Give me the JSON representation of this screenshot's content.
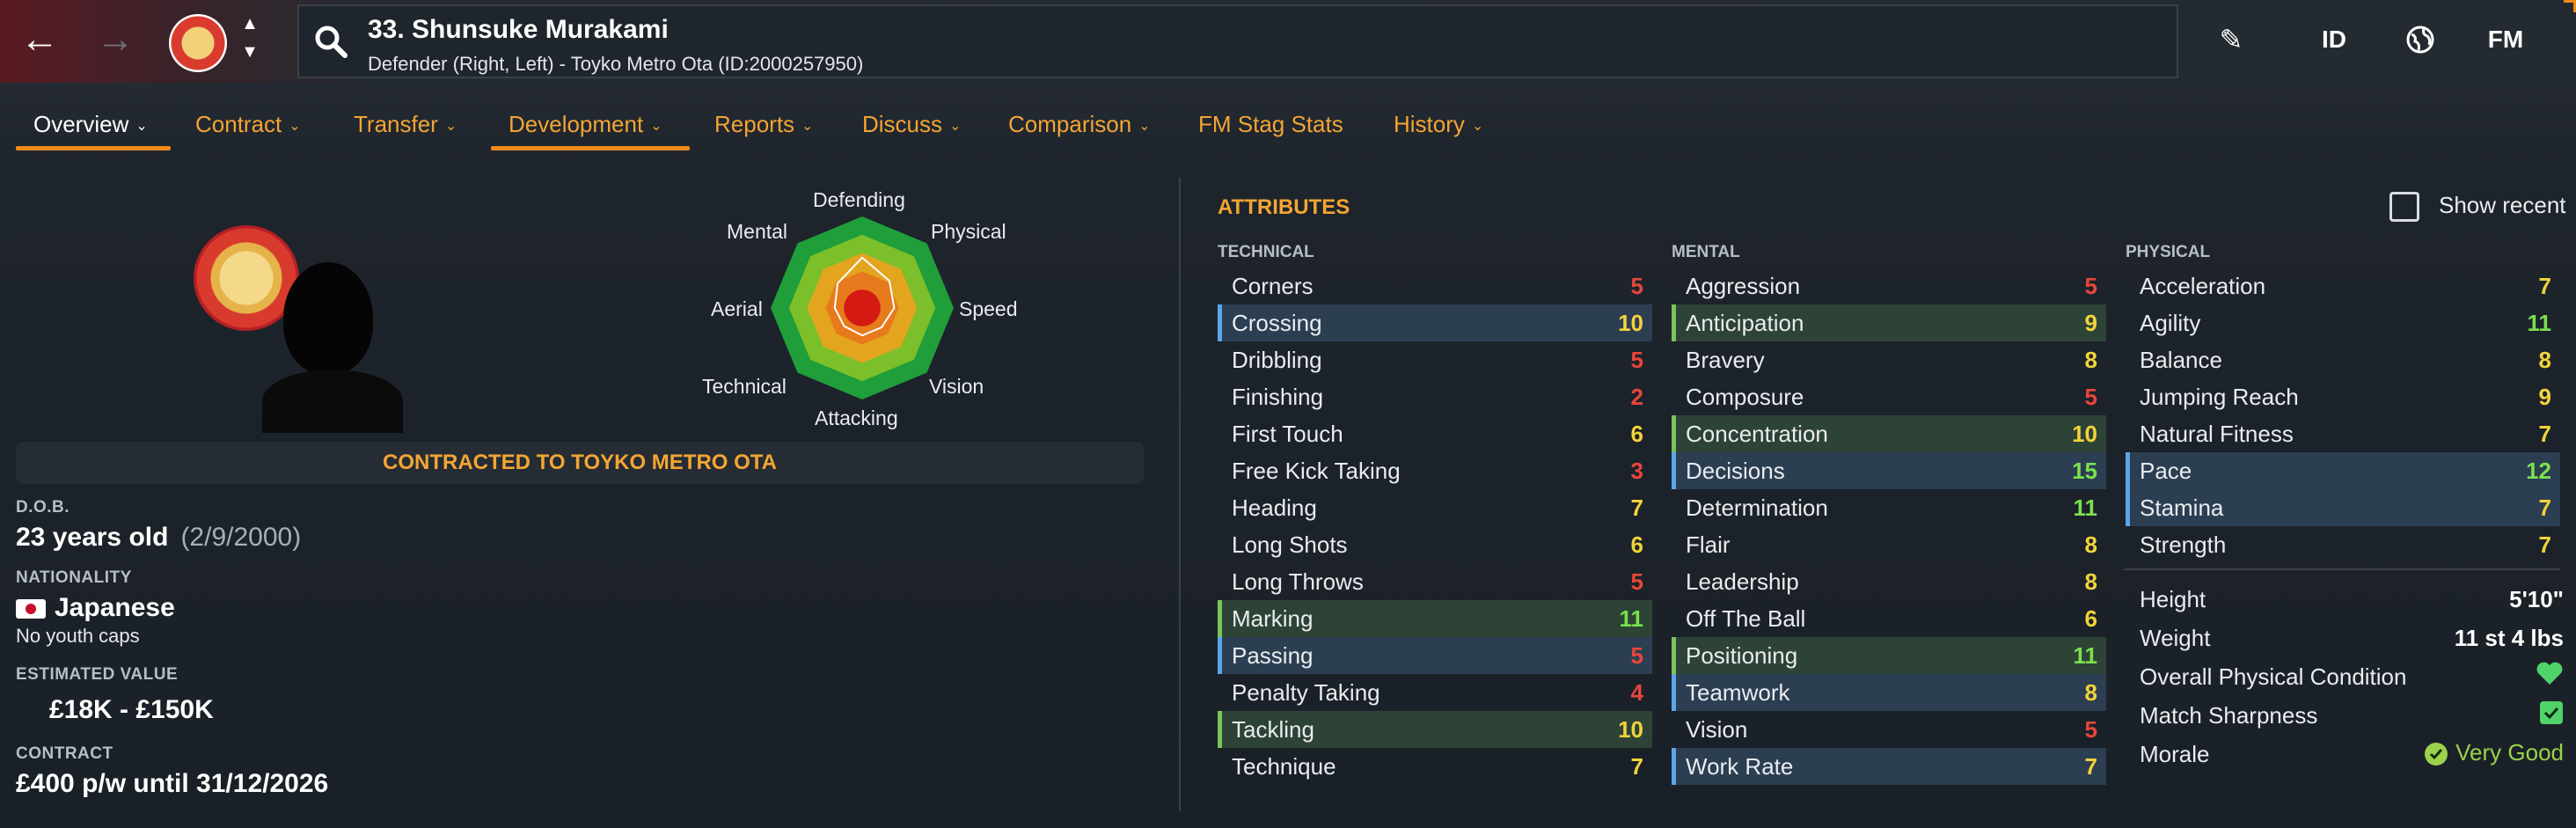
{
  "header": {
    "title": "33. Shunsuke Murakami",
    "subtitle": "Defender (Right, Left) - Toyko Metro Ota (ID:2000257950)",
    "right_icons": [
      {
        "name": "edit-icon",
        "label": "✎"
      },
      {
        "name": "id-icon",
        "label": "ID"
      },
      {
        "name": "globe-icon",
        "label": "🌐"
      },
      {
        "name": "fm-icon",
        "label": "FM"
      }
    ]
  },
  "tabs": [
    {
      "label": "Overview",
      "active": true
    },
    {
      "label": "Contract"
    },
    {
      "label": "Transfer"
    },
    {
      "label": "Development",
      "highlight": true
    },
    {
      "label": "Reports"
    },
    {
      "label": "Discuss"
    },
    {
      "label": "Comparison"
    },
    {
      "label": "FM Stag Stats",
      "no_chevron": true
    },
    {
      "label": "History"
    }
  ],
  "profile": {
    "contract_banner": "CONTRACTED TO TOYKO METRO OTA",
    "dob_label": "D.O.B.",
    "age": "23 years old",
    "dob": "(2/9/2000)",
    "nationality_label": "NATIONALITY",
    "nationality": "Japanese",
    "caps": "No youth caps",
    "value_label": "ESTIMATED VALUE",
    "value": "£18K - £150K",
    "contract_label": "CONTRACT",
    "contract": "£400 p/w until 31/12/2026"
  },
  "radar": {
    "labels": [
      "Defending",
      "Physical",
      "Speed",
      "Vision",
      "Attacking",
      "Technical",
      "Aerial",
      "Mental"
    ],
    "values": [
      0.55,
      0.42,
      0.35,
      0.3,
      0.3,
      0.28,
      0.3,
      0.38
    ]
  },
  "attributes": {
    "title": "ATTRIBUTES",
    "show_recent": "Show recent",
    "technical": {
      "label": "TECHNICAL",
      "items": [
        {
          "name": "Corners",
          "value": "5"
        },
        {
          "name": "Crossing",
          "value": "10",
          "hl": "blue"
        },
        {
          "name": "Dribbling",
          "value": "5"
        },
        {
          "name": "Finishing",
          "value": "2"
        },
        {
          "name": "First Touch",
          "value": "6"
        },
        {
          "name": "Free Kick Taking",
          "value": "3"
        },
        {
          "name": "Heading",
          "value": "7"
        },
        {
          "name": "Long Shots",
          "value": "6"
        },
        {
          "name": "Long Throws",
          "value": "5"
        },
        {
          "name": "Marking",
          "value": "11",
          "hl": "green"
        },
        {
          "name": "Passing",
          "value": "5",
          "hl": "blue"
        },
        {
          "name": "Penalty Taking",
          "value": "4"
        },
        {
          "name": "Tackling",
          "value": "10",
          "hl": "green"
        },
        {
          "name": "Technique",
          "value": "7"
        }
      ]
    },
    "mental": {
      "label": "MENTAL",
      "items": [
        {
          "name": "Aggression",
          "value": "5"
        },
        {
          "name": "Anticipation",
          "value": "9",
          "hl": "green"
        },
        {
          "name": "Bravery",
          "value": "8"
        },
        {
          "name": "Composure",
          "value": "5"
        },
        {
          "name": "Concentration",
          "value": "10",
          "hl": "green"
        },
        {
          "name": "Decisions",
          "value": "15",
          "hl": "blue"
        },
        {
          "name": "Determination",
          "value": "11"
        },
        {
          "name": "Flair",
          "value": "8"
        },
        {
          "name": "Leadership",
          "value": "8"
        },
        {
          "name": "Off The Ball",
          "value": "6"
        },
        {
          "name": "Positioning",
          "value": "11",
          "hl": "green"
        },
        {
          "name": "Teamwork",
          "value": "8",
          "hl": "blue"
        },
        {
          "name": "Vision",
          "value": "5"
        },
        {
          "name": "Work Rate",
          "value": "7",
          "hl": "blue"
        }
      ]
    },
    "physical": {
      "label": "PHYSICAL",
      "items": [
        {
          "name": "Acceleration",
          "value": "7"
        },
        {
          "name": "Agility",
          "value": "11"
        },
        {
          "name": "Balance",
          "value": "8"
        },
        {
          "name": "Jumping Reach",
          "value": "9"
        },
        {
          "name": "Natural Fitness",
          "value": "7"
        },
        {
          "name": "Pace",
          "value": "12",
          "hl": "blue"
        },
        {
          "name": "Stamina",
          "value": "7",
          "hl": "blue"
        },
        {
          "name": "Strength",
          "value": "7"
        }
      ]
    }
  },
  "physical_info": {
    "height_label": "Height",
    "height": "5'10\"",
    "weight_label": "Weight",
    "weight": "11 st 4 lbs",
    "condition_label": "Overall Physical Condition",
    "sharpness_label": "Match Sharpness",
    "morale_label": "Morale",
    "morale": "Very Good"
  },
  "colors": {
    "low": "#e8463c",
    "mid_low": "#f08a2a",
    "mid": "#f2d33a",
    "high": "#7be04e",
    "accent": "#f3a534"
  }
}
